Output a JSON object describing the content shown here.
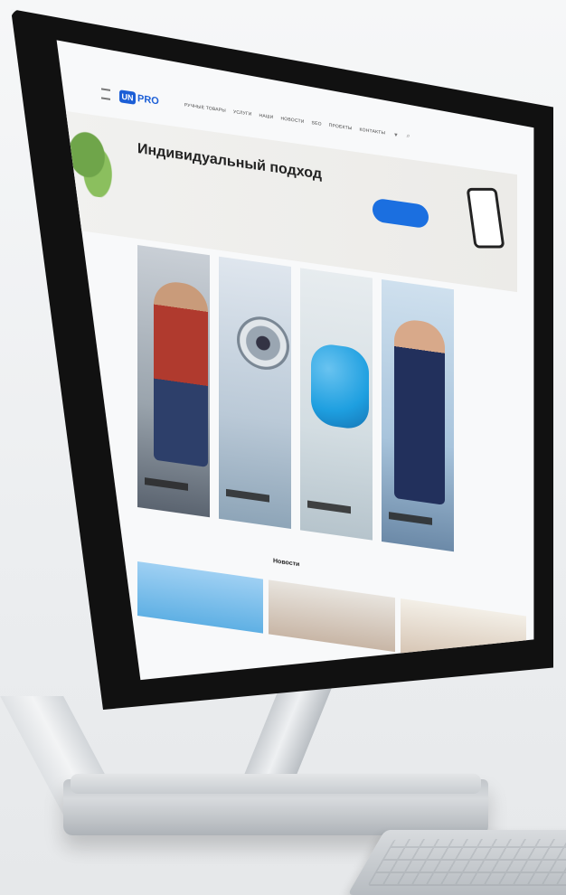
{
  "site": {
    "logo": {
      "mark": "UN",
      "text": "PRO"
    },
    "nav": [
      "Ручные товары",
      "Услуги",
      "Наши",
      "Новости",
      "SEO",
      "Проекты",
      "Контакты"
    ],
    "hero": {
      "title": "Индивидуальный подход",
      "subtitle": "",
      "button": ""
    },
    "tiles": [
      {
        "label": ""
      },
      {
        "label": ""
      },
      {
        "label": ""
      },
      {
        "label": ""
      }
    ],
    "news_title": "Новости"
  },
  "colors": {
    "accent": "#1b6fe0",
    "background": "#eef0f2"
  }
}
